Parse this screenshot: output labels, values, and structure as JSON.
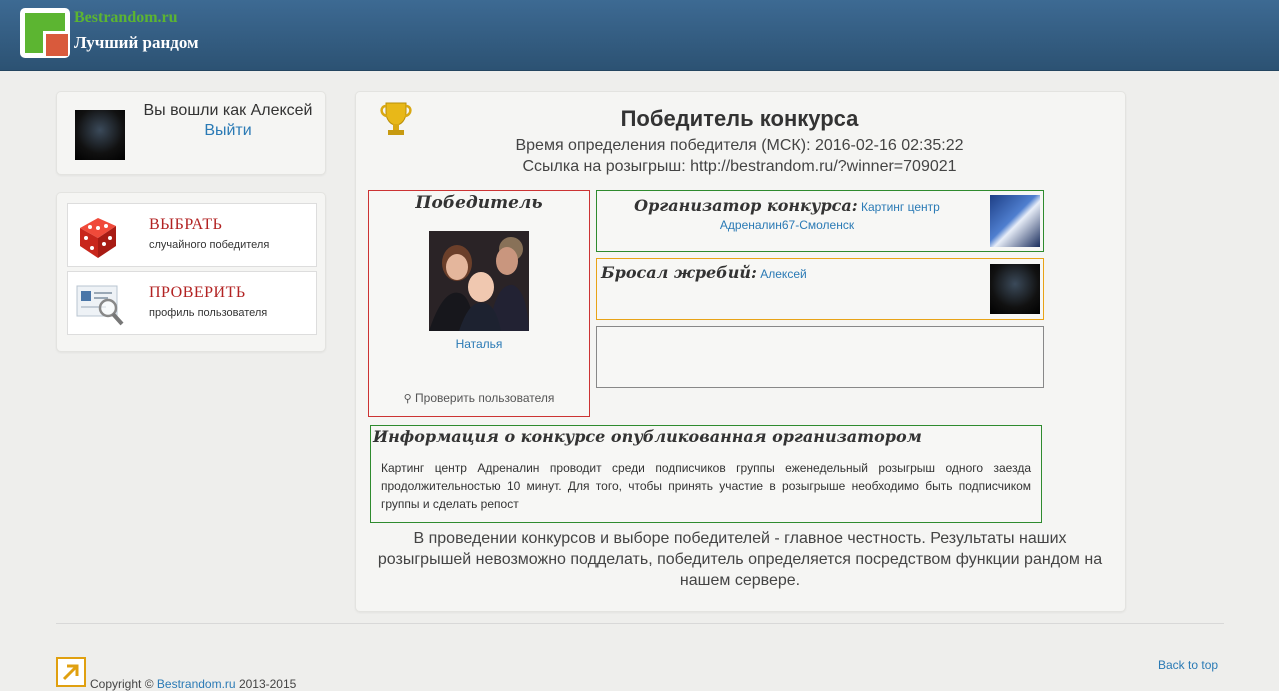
{
  "header": {
    "site_name": "Bestrandom.ru",
    "tagline": "Лучший рандом"
  },
  "sidebar": {
    "user": {
      "logged_in_text": "Вы вошли как Алексей",
      "logout_label": "Выйти"
    },
    "actions": [
      {
        "title": "ВЫБРАТЬ",
        "subtitle": "случайного победителя",
        "icon": "dice-icon"
      },
      {
        "title": "ПРОВЕРИТЬ",
        "subtitle": "профиль пользователя",
        "icon": "profile-magnifier-icon"
      }
    ]
  },
  "contest": {
    "title": "Победитель конкурса",
    "time_text": "Время определения победителя (МСК): 2016-02-16 02:35:22",
    "link_text": "Ссылка на розыгрыш: http://bestrandom.ru/?winner=709021",
    "winner": {
      "heading": "Победитель",
      "name": "Наталья",
      "check_label": "Проверить пользователя"
    },
    "organizer": {
      "heading": "Организатор конкурса:",
      "name_line1": "Картинг центр",
      "name_line2": "Адреналин67-Смоленск"
    },
    "drawer": {
      "heading": "Бросал жребий:",
      "name": "Алексей"
    },
    "info": {
      "heading": "Информация о конкурсе опубликованная организатором",
      "text": "Картинг центр Адреналин проводит среди подписчиков группы еженедельный розыгрыш одного заезда продолжительностью 10 минут. Для того, чтобы принять участие в розыгрыше необходимо быть подписчиком группы и сделать репост"
    },
    "honesty_text": "В проведении конкурсов и выборе победителей - главное честность. Результаты наших розыгрышей невозможно подделать, победитель определяется посредством функции рандом на нашем сервере."
  },
  "footer": {
    "copyright_prefix": "Copyright ©",
    "copyright_link": "Bestrandom.ru",
    "copyright_years": "2013-2015",
    "back_to_top": "Back to top"
  },
  "colors": {
    "header_bg": "#2c5273",
    "accent_red": "#b22222",
    "link": "#2a7ab5",
    "winner_border": "#cc3333",
    "organizer_border": "#2e8b2e",
    "drawer_border": "#e8a317",
    "info_border": "#2e8b2e"
  }
}
